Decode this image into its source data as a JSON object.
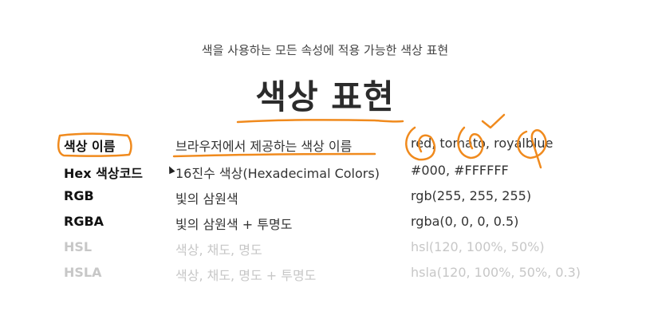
{
  "subtitle": "색을 사용하는 모든 속성에 적용 가능한 색상 표현",
  "title": "색상 표현",
  "rows": [
    {
      "name": "색상 이름",
      "desc": "브라우저에서 제공하는 색상 이름",
      "example": "red, tomato, royalblue"
    },
    {
      "name": "Hex 색상코드",
      "desc": "16진수 색상(Hexadecimal Colors)",
      "example": "#000, #FFFFFF"
    },
    {
      "name": "RGB",
      "desc": "빛의 삼원색",
      "example": "rgb(255, 255, 255)"
    },
    {
      "name": "RGBA",
      "desc": "빛의 삼원색 + 투명도",
      "example": "rgba(0, 0, 0, 0.5)"
    },
    {
      "name": "HSL",
      "desc": "색상, 채도, 명도",
      "example": "hsl(120, 100%, 50%)"
    },
    {
      "name": "HSLA",
      "desc": "색상, 채도, 명도 + 투명도",
      "example": "hsla(120, 100%, 50%, 0.3)"
    }
  ],
  "colors": {
    "annotation": "#f08a1d",
    "faded_text": "#c7c7c7",
    "text": "#333333"
  }
}
